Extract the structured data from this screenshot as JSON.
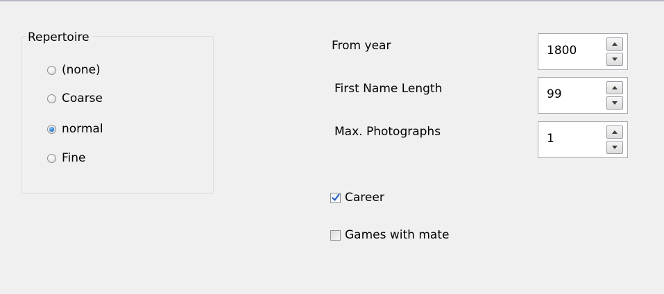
{
  "repertoire": {
    "title": "Repertoire",
    "options": [
      {
        "label": "(none)",
        "selected": false
      },
      {
        "label": "Coarse",
        "selected": false
      },
      {
        "label": "normal",
        "selected": true
      },
      {
        "label": "Fine",
        "selected": false
      }
    ]
  },
  "fields": {
    "from_year": {
      "label": "From year",
      "value": "1800"
    },
    "first_name_length": {
      "label": "First Name Length",
      "value": "99"
    },
    "max_photographs": {
      "label": "Max. Photographs",
      "value": "1"
    }
  },
  "checkboxes": {
    "career": {
      "label": "Career",
      "checked": true
    },
    "games_with_mate": {
      "label": "Games with mate",
      "checked": false
    }
  },
  "icons": {
    "spin_up": "chevron-up-icon",
    "spin_down": "chevron-down-icon",
    "check": "checkmark-icon"
  },
  "colors": {
    "background": "#f0f0f0",
    "checkmark": "#2b5cc4",
    "radio_selected": "#2a7bd4"
  }
}
